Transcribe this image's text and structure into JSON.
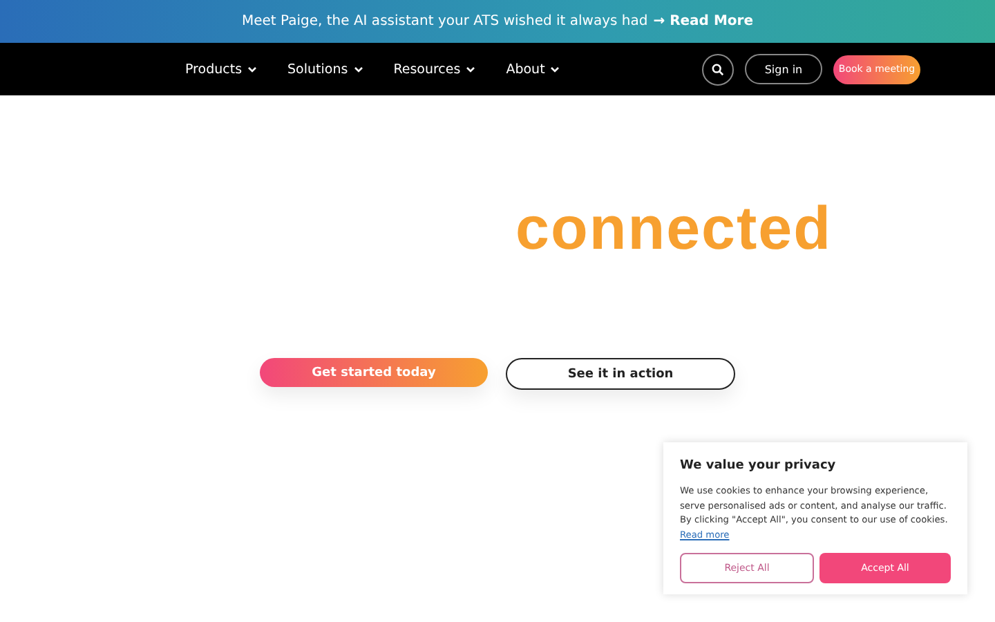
{
  "banner": {
    "text": "Meet Paige, the AI assistant your ATS wished it always had",
    "link": "→ Read More"
  },
  "nav": {
    "items": [
      {
        "label": "Products"
      },
      {
        "label": "Solutions"
      },
      {
        "label": "Resources"
      },
      {
        "label": "About"
      }
    ],
    "sign_in": "Sign in",
    "cta": "Book a meeting"
  },
  "hero": {
    "headline": "connected",
    "primary": "Get started today",
    "secondary": "See it in action"
  },
  "cookie": {
    "title": "We value your privacy",
    "body": "We use cookies to enhance your browsing experience, serve personalised ads or content, and analyse our traffic. By clicking \"Accept All\", you consent to our use of cookies.",
    "link": "Read more",
    "reject": "Reject All",
    "accept": "Accept All"
  }
}
